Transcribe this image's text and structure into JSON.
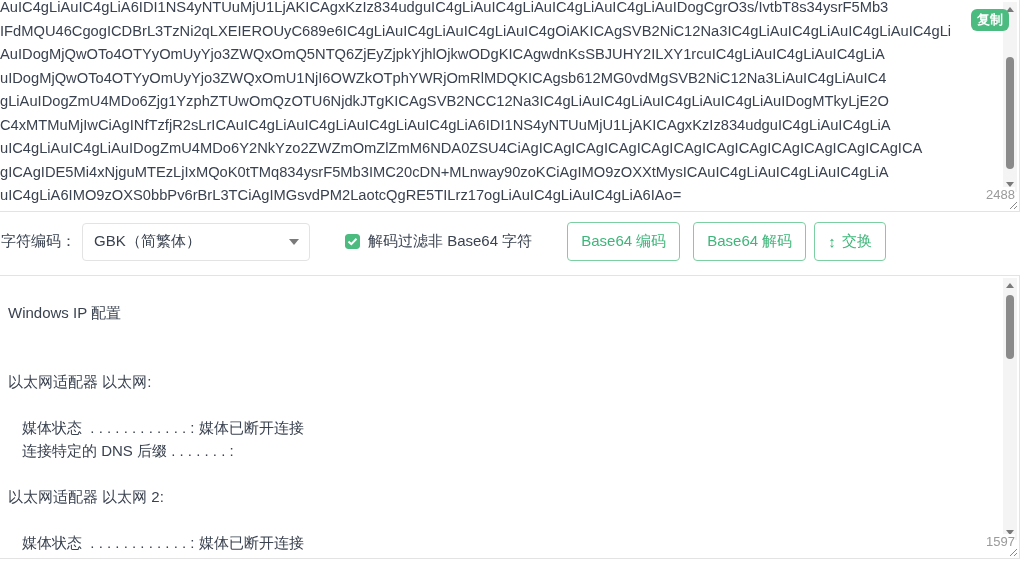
{
  "input_panel": {
    "lines": [
      "AuIC4gLiAuIC4gLiA6IDI1NS4yNTUuMjU1LjAKICAgxKzIz834udguIC4gLiAuIC4gLiAuIC4gLiAuIC4gLiAuIDogCgrO3s/IvtbT8s34ysrF5Mb3",
      "IFdMQU46CgogICDBrL3TzNi2qLXEIEROUyC689e6IC4gLiAuIC4gLiAuIC4gLiAuIC4gOiAKICAgSVB2NiC12Na3IC4gLiAuIC4gLiAuIC4gLiAuIC4gLi",
      "AuIDogMjQwOTo4OTYyOmUyYjo3ZWQxOmQ5NTQ6ZjEyZjpkYjhlOjkwODgKICAgwdnKsSBJUHY2ILXY1rcuIC4gLiAuIC4gLiAuIC4gLiA",
      "uIDogMjQwOTo4OTYyOmUyYjo3ZWQxOmU1NjI6OWZkOTphYWRjOmRlMDQKICAgsb612MG0vdMgSVB2NiC12Na3LiAuIC4gLiAuIC4",
      "gLiAuIDogZmU4MDo6Zjg1YzphZTUwOmQzOTU6NjdkJTgKICAgSVB2NCC12Na3IC4gLiAuIC4gLiAuIC4gLiAuIC4gLiAuIDogMTkyLjE2O",
      "C4xMTMuMjIwCiAgINfTzfjR2sLrICAuIC4gLiAuIC4gLiAuIC4gLiAuIC4gLiA6IDI1NS4yNTUuMjU1LjAKICAgxKzIz834udguIC4gLiAuIC4gLiA",
      "uIC4gLiAuIC4gLiAuIDogZmU4MDo6Y2NkYzo2ZWZmOmZlZmM6NDA0ZSU4CiAgICAgICAgICAgICAgICAgICAgICAgICAgICAgICAgICAgICA",
      "gICAgIDE5Mi4xNjguMTEzLjIxMQoK0tTMq834ysrF5Mb3IMC20cDN+MLnway90zoKCiAgIMO9zOXXtMysICAuIC4gLiAuIC4gLiAuIC4gLiA",
      "uIC4gLiA6IMO9zOXS0bbPv6rBrL3TCiAgIMGsvdPM2LaotcQgRE5TILrz17ogLiAuIC4gLiAuIC4gLiA6IAo="
    ],
    "copy_badge": "复制",
    "char_count": "2488"
  },
  "controls": {
    "encoding_label": "字符编码：",
    "encoding_select": {
      "value": "GBK（简繁体）"
    },
    "filter_checkbox": {
      "label": "解码过滤非 Base64 字符",
      "checked": true
    },
    "buttons": [
      {
        "label": "Base64 编码"
      },
      {
        "label": "Base64 解码"
      },
      {
        "icon": "↕",
        "label": "交换"
      }
    ]
  },
  "output_panel": {
    "title": "Windows IP 配置",
    "sections": [
      {
        "heading": "以太网适配器 以太网:",
        "entries": [
          "媒体状态  . . . . . . . . . . . . : 媒体已断开连接",
          "连接特定的 DNS 后缀 . . . . . . . :"
        ]
      },
      {
        "heading": "以太网适配器 以太网 2:",
        "entries": [
          "媒体状态  . . . . . . . . . . . . : 媒体已断开连接"
        ]
      }
    ],
    "char_count": "1597"
  }
}
